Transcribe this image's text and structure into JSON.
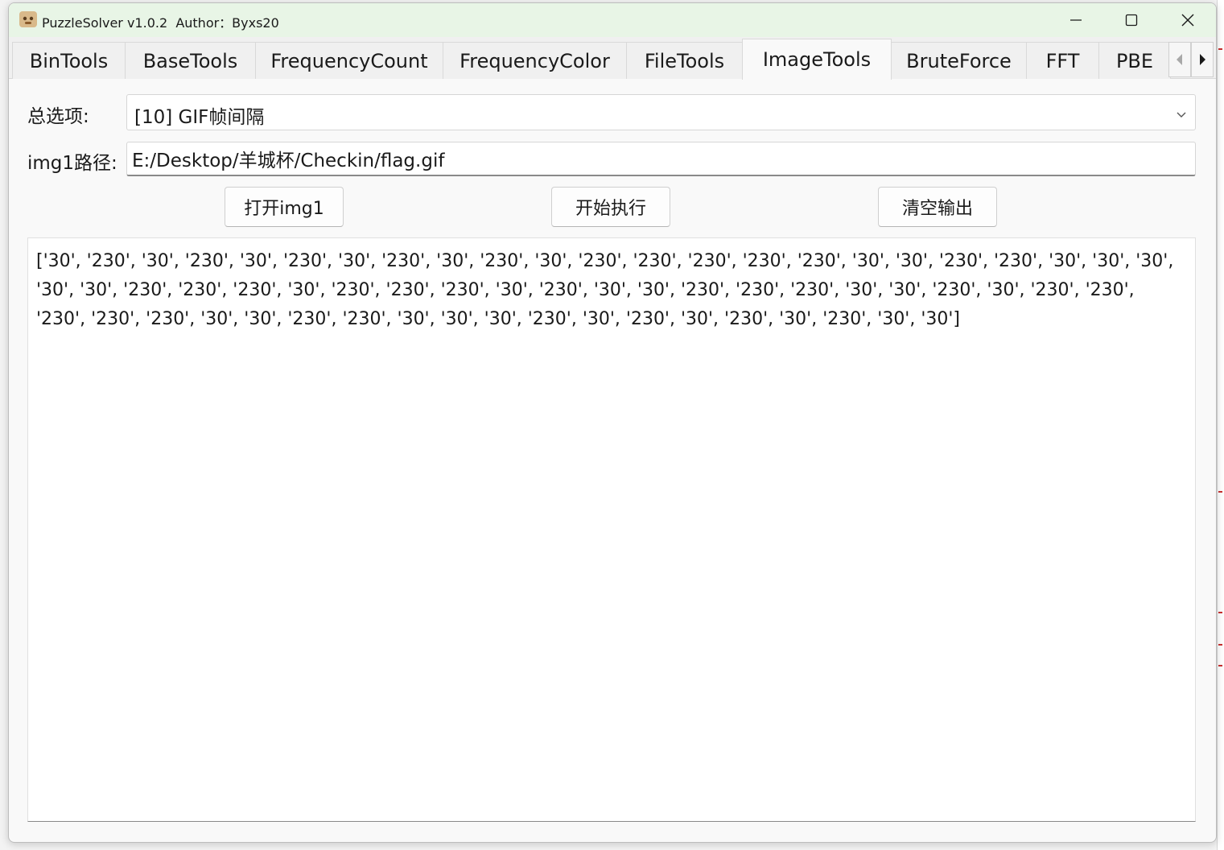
{
  "window": {
    "title": "PuzzleSolver v1.0.2  Author：Byxs20"
  },
  "tabs": [
    {
      "label": "BinTools",
      "active": false
    },
    {
      "label": "BaseTools",
      "active": false
    },
    {
      "label": "FrequencyCount",
      "active": false
    },
    {
      "label": "FrequencyColor",
      "active": false
    },
    {
      "label": "FileTools",
      "active": false
    },
    {
      "label": "ImageTools",
      "active": true
    },
    {
      "label": "BruteForce",
      "active": false
    },
    {
      "label": "FFT",
      "active": false
    },
    {
      "label": "PBE",
      "active": false
    }
  ],
  "form": {
    "mode_label": "总选项:",
    "mode_value": "[10] GIF帧间隔",
    "img1_label": "img1路径:",
    "img1_value": "E:/Desktop/羊城杯/Checkin/flag.gif"
  },
  "buttons": {
    "open_img1": "打开img1",
    "run": "开始执行",
    "clear": "清空输出"
  },
  "output": {
    "text": "['30', '230', '30', '230', '30', '230', '30', '230', '30', '230', '30', '230', '230', '230', '230', '230', '30', '30', '230', '230', '30', '30', '30', '30', '30', '230', '230', '230', '30', '230', '230', '230', '30', '230', '30', '30', '230', '230', '230', '30', '30', '230', '30', '230', '230', '230', '230', '230', '30', '30', '230', '230', '30', '30', '30', '230', '30', '230', '30', '230', '30', '230', '30', '30']"
  },
  "colors": {
    "titlebar_bg": "#e8f5e6",
    "window_bg": "#f9f9f9"
  }
}
